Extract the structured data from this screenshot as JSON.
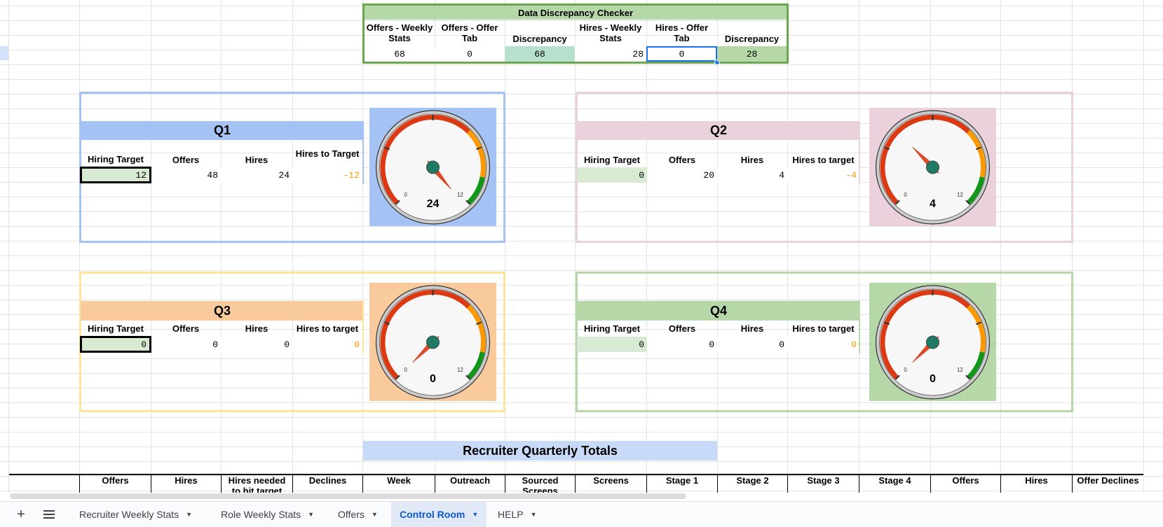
{
  "checker": {
    "title": "Data Discrepancy Checker",
    "headers": [
      "Offers - Weekly Stats",
      "Offers - Offer Tab",
      "Discrepancy",
      "Hires - Weekly Stats",
      "Hires - Offer Tab",
      "Discrepancy"
    ],
    "values": [
      "68",
      "0",
      "68",
      "28",
      "0",
      "28"
    ]
  },
  "quarters": [
    {
      "title": "Q1",
      "headers": [
        "Hiring Target",
        "Offers",
        "Hires",
        "Hires to Target"
      ],
      "values": [
        "12",
        "48",
        "24",
        "-12"
      ],
      "gauge": {
        "value": 24,
        "min": 0,
        "max": 12,
        "min_label": "0",
        "max_label": "12",
        "display": "24",
        "bg": "#a4c2f4"
      },
      "colors": {
        "border": "#a4c2f4",
        "header": "#a4c2f4"
      }
    },
    {
      "title": "Q2",
      "headers": [
        "Hiring Target",
        "Offers",
        "Hires",
        "Hires to target"
      ],
      "values": [
        "0",
        "20",
        "4",
        "-4"
      ],
      "gauge": {
        "value": 4,
        "min": 0,
        "max": 12,
        "min_label": "0",
        "max_label": "12",
        "display": "4",
        "bg": "#ead1dc"
      },
      "colors": {
        "border": "#ead1dc",
        "header": "#ead1dc"
      }
    },
    {
      "title": "Q3",
      "headers": [
        "Hiring Target",
        "Offers",
        "Hires",
        "Hires to target"
      ],
      "values": [
        "0",
        "0",
        "0",
        "0"
      ],
      "gauge": {
        "value": 0,
        "min": 0,
        "max": 12,
        "min_label": "0",
        "max_label": "12",
        "display": "0",
        "bg": "#f9cb9c"
      },
      "colors": {
        "border": "#ffe599",
        "header": "#f9cb9c"
      }
    },
    {
      "title": "Q4",
      "headers": [
        "Hiring Target",
        "Offers",
        "Hires",
        "Hires to target"
      ],
      "values": [
        "0",
        "0",
        "0",
        "0"
      ],
      "gauge": {
        "value": 0,
        "min": 0,
        "max": 12,
        "min_label": "0",
        "max_label": "12",
        "display": "0",
        "bg": "#b6d7a8"
      },
      "colors": {
        "border": "#b6d7a8",
        "header": "#b6d7a8"
      }
    }
  ],
  "recruiter": {
    "title": "Recruiter Quarterly Totals",
    "headers": [
      "Offers",
      "Hires",
      "Hires needed to hit target",
      "Declines",
      "Week",
      "Outreach",
      "Sourced Screens",
      "Screens",
      "Stage 1",
      "Stage 2",
      "Stage 3",
      "Stage 4",
      "Offers",
      "Hires",
      "Offer Declines"
    ]
  },
  "tabs": [
    {
      "label": "Recruiter Weekly Stats"
    },
    {
      "label": "Role Weekly Stats"
    },
    {
      "label": "Offers"
    },
    {
      "label": "Control Room",
      "active": true
    },
    {
      "label": "HELP"
    }
  ],
  "colors": {
    "accent": "#0b57d0",
    "checker_border": "#6aa84f",
    "checker_title_bg": "#b6d7a8",
    "target_cell": "#d9ead3",
    "negative": "#ff9900",
    "disc1_bg": "#b7e1cd",
    "disc2_bg": "#b6d7a8"
  }
}
